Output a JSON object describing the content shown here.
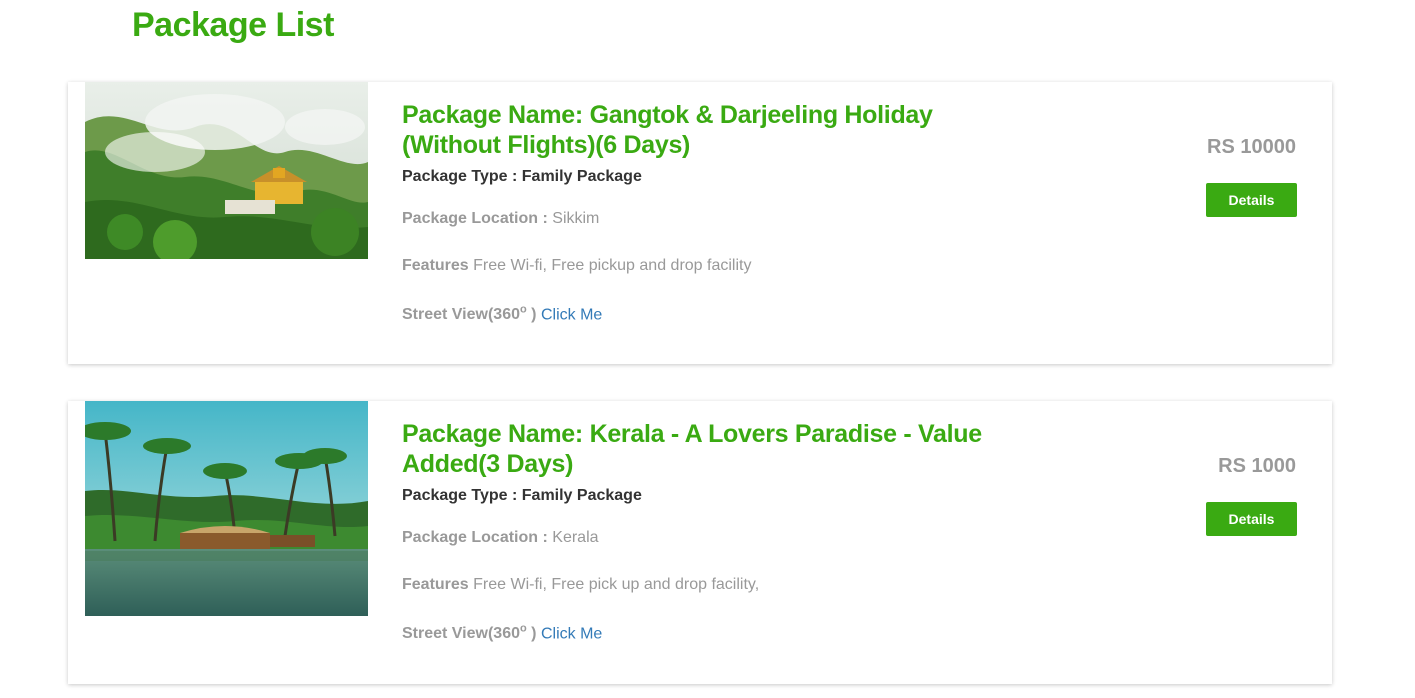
{
  "page": {
    "title": "Package List"
  },
  "labels": {
    "type_prefix": "Package Type : ",
    "location_prefix": "Package Location : ",
    "features_prefix": "Features ",
    "street_prefix": "Street View(360",
    "street_degree": "o",
    "street_suffix": " ) ",
    "click_me": "Click Me",
    "details": "Details"
  },
  "packages": [
    {
      "name": "Package Name: Gangtok & Darjeeling Holiday (Without Flights)(6 Days)",
      "type": "Family Package",
      "location": "Sikkim",
      "features": "Free Wi-fi, Free pickup and drop facility",
      "price": "RS 10000",
      "image": "mountain-monastery-photo"
    },
    {
      "name": "Package Name: Kerala - A Lovers Paradise - Value Added(3 Days)",
      "type": "Family Package",
      "location": "Kerala",
      "features": "Free Wi-fi, Free pick up and drop facility,",
      "price": "RS 1000",
      "image": "kerala-backwaters-houseboat-photo"
    }
  ],
  "colors": {
    "accent": "#3aaa12",
    "muted": "#999999",
    "link": "#337ab7"
  }
}
